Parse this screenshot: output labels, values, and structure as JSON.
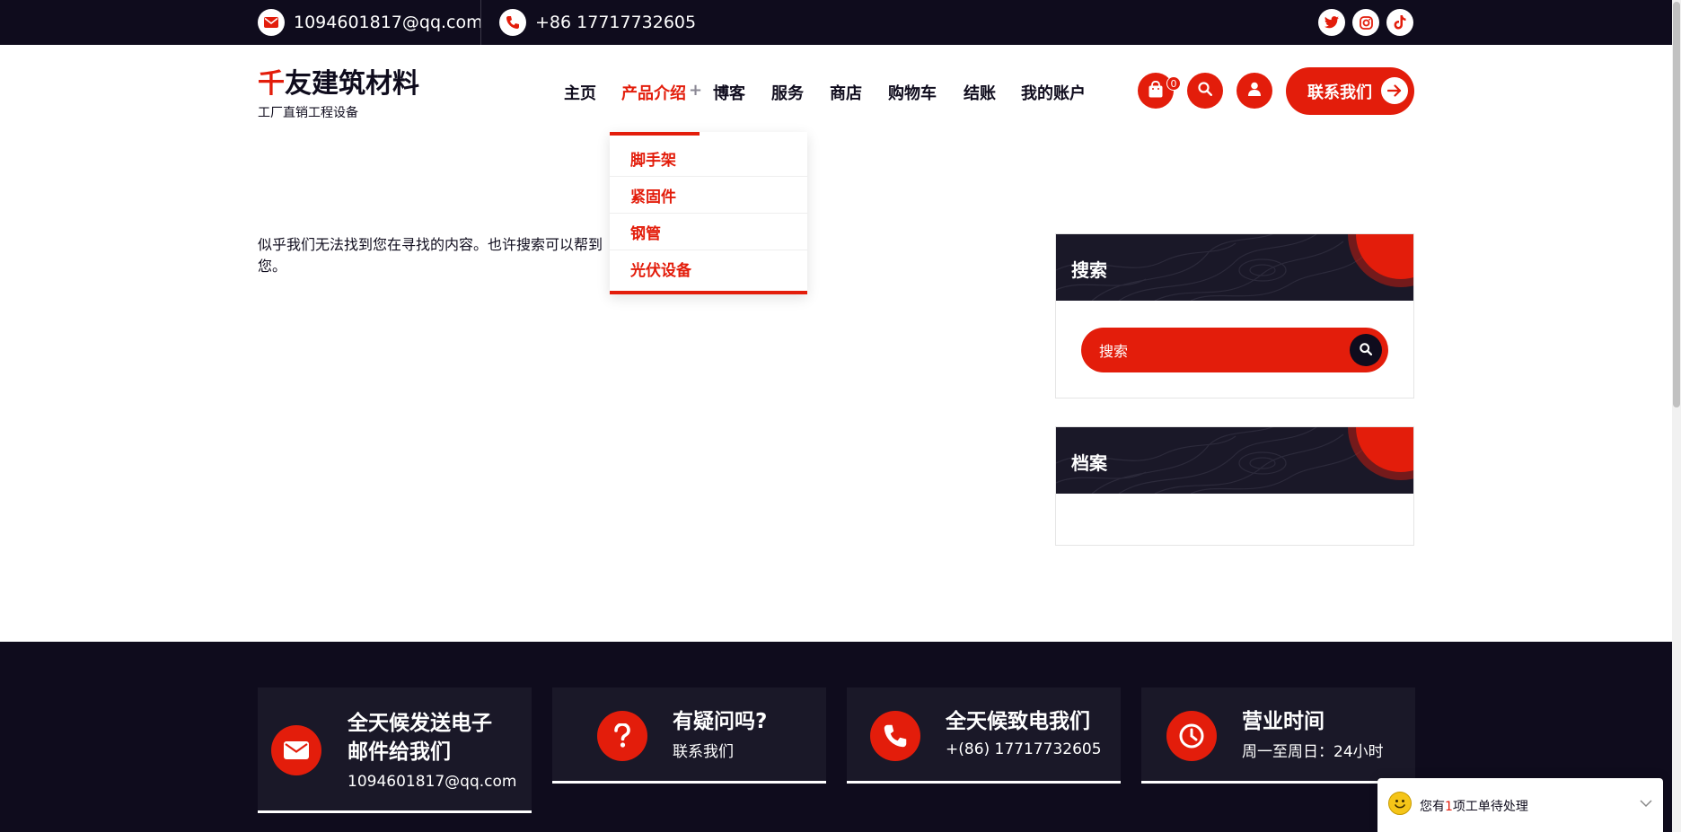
{
  "topbar": {
    "email": "1094601817@qq.com",
    "phone": "+86 17717732605",
    "social": [
      "twitter-icon",
      "instagram-icon",
      "tiktok-icon"
    ]
  },
  "header": {
    "logo_accent": "千",
    "logo_rest": "友建筑材料",
    "logo_sub": "工厂直销工程设备",
    "nav": [
      "主页",
      "产品介绍",
      "博客",
      "服务",
      "商店",
      "购物车",
      "结账",
      "我的账户"
    ],
    "nav_plus": "+",
    "cart_count": "0",
    "contact_label": "联系我们"
  },
  "dropdown": {
    "items": [
      "脚手架",
      "紧固件",
      "钢管",
      "光伏设备"
    ]
  },
  "content": {
    "notfound_text": "似乎我们无法找到您在寻找的内容。也许搜索可以帮到您。"
  },
  "sidebar": {
    "search_title": "搜索",
    "search_placeholder": "搜索",
    "archive_title": "档案"
  },
  "footer": {
    "cards": [
      {
        "title_line1": "全天候发送电子",
        "title_line2": "邮件给我们",
        "sub": "1094601817@qq.com",
        "icon": "envelope-icon"
      },
      {
        "title_line1": "有疑问吗?",
        "sub": "联系我们",
        "icon": "question-icon"
      },
      {
        "title_line1": "全天候致电我们",
        "sub": "+(86) 17717732605",
        "icon": "phone-icon"
      },
      {
        "title_line1": "营业时间",
        "sub": "周一至周日：24小时",
        "icon": "clock-icon"
      }
    ]
  },
  "notification": {
    "prefix": "您有",
    "count": "1",
    "suffix": "项工单待处理"
  },
  "colors": {
    "accent": "#e31d0b",
    "dark": "#0f0c1d"
  }
}
